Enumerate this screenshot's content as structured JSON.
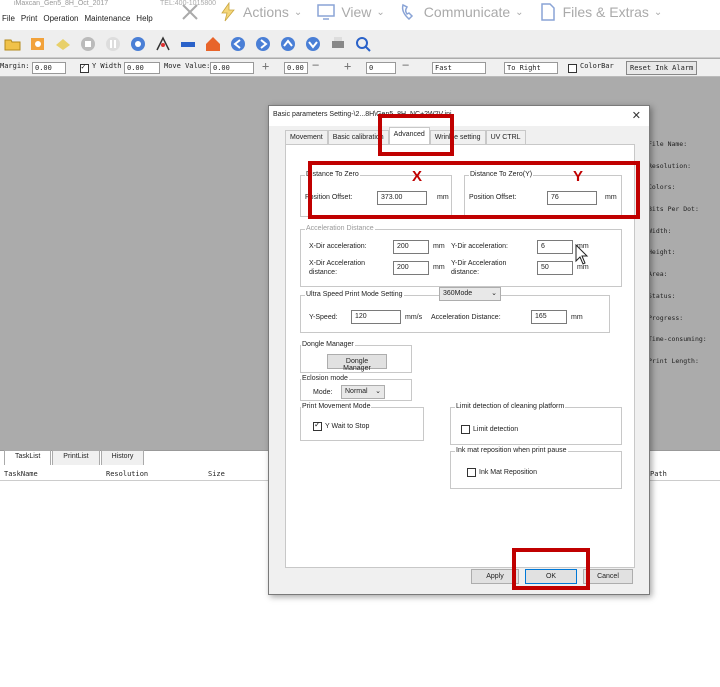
{
  "app": {
    "title": "iMaxcan_Gen5_8H_Oct_2017",
    "tel": "TEL:400-1015800",
    "menu": [
      "File",
      "Print",
      "Operation",
      "Maintenance",
      "Help"
    ],
    "ribbon": [
      {
        "label": "Actions",
        "icon": "lightning-icon"
      },
      {
        "label": "View",
        "icon": "monitor-icon"
      },
      {
        "label": "Communicate",
        "icon": "phone-icon"
      },
      {
        "label": "Files & Extras",
        "icon": "file-icon"
      }
    ]
  },
  "parambar": {
    "margin_label": "Margin:",
    "margin_value": "0.00",
    "ywidth_label": "Y Width",
    "ywidth_value": "0.00",
    "move_label": "Move Value:",
    "move_value": "0.00",
    "step1_value": "0.00",
    "step2_value": "0",
    "speed_value": "Fast",
    "dir_value": "To Right",
    "colorbar_label": "ColorBar",
    "reset_label": "Reset Ink Alarm"
  },
  "info_panel": [
    "File Name:",
    "Resolution:",
    "Colors:",
    "Bits Per Dot:",
    "Width:",
    "Height:",
    "Area:",
    "Status:",
    "Progress:",
    "Time-consuming:",
    "Print Length:"
  ],
  "bottom": {
    "tabs": [
      "TaskList",
      "PrintList",
      "History"
    ],
    "columns": [
      "TaskName",
      "Resolution",
      "Size",
      "Path"
    ]
  },
  "dialog": {
    "title": "Basic parameters Setting-\\2...8H\\Gen5_8H_NC+2W2V.ini",
    "tabs": [
      "Movement",
      "Basic calibration",
      "Advanced",
      "Wrinkle setting",
      "UV CTRL"
    ],
    "dist_x": {
      "title": "Distance To Zero",
      "label": "Position Offset:",
      "value": "373.00",
      "unit": "mm"
    },
    "dist_y": {
      "title": "Distance To Zero(Y)",
      "label": "Position Offset:",
      "value": "76",
      "unit": "mm"
    },
    "accel": {
      "title": "Acceleration Distance",
      "x_acc_label": "X-Dir acceleration:",
      "x_acc_value": "200",
      "x_acc_unit": "mm",
      "x_dist_label": "X-Dir Acceleration distance:",
      "x_dist_value": "200",
      "x_dist_unit": "mm",
      "y_acc_label": "Y-Dir acceleration:",
      "y_acc_value": "6",
      "y_acc_unit": "mm",
      "y_dist_label": "Y-Dir Acceleration distance:",
      "y_dist_value": "50",
      "y_dist_unit": "mm"
    },
    "ultra": {
      "title": "Ultra Speed Print Mode Setting",
      "mode": "360Mode",
      "yspeed_label": "Y-Speed:",
      "yspeed_value": "120",
      "yspeed_unit": "mm/s",
      "accdist_label": "Acceleration Distance:",
      "accdist_value": "165",
      "accdist_unit": "mm"
    },
    "dongle": {
      "title": "Dongle Manager",
      "button": "Dongle Manager"
    },
    "eclosion": {
      "title": "Eclosion mode",
      "mode_label": "Mode:",
      "mode_value": "Normal"
    },
    "movement": {
      "title": "Print Movement Mode",
      "check_label": "Y Wait to Stop",
      "checked": true
    },
    "limit": {
      "title": "Limit detection of cleaning platform",
      "check_label": "Limit detection",
      "checked": false
    },
    "inkmat": {
      "title": "Ink mat reposition when print pause",
      "check_label": "Ink Mat Reposition",
      "checked": false
    },
    "buttons": {
      "apply": "Apply",
      "ok": "OK",
      "cancel": "Cancel"
    }
  },
  "annotations": {
    "x_label": "X",
    "y_label": "Y",
    "color": "#c00000"
  }
}
